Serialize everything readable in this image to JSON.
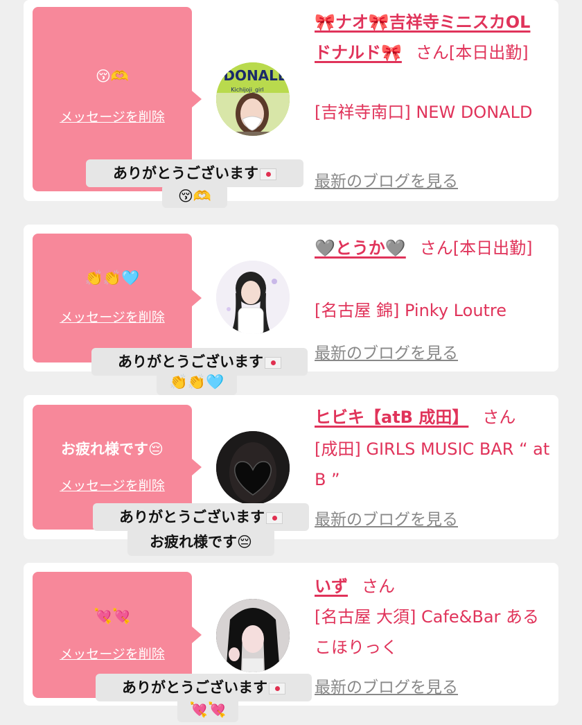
{
  "delete_label": "メッセージを削除",
  "san_label": "さん",
  "blog_label": "最新のブログを見る",
  "colors": {
    "bubble": "#f7889a",
    "link": "#e0335a",
    "muted": "#888888",
    "page_bg": "#efefef"
  },
  "entries": [
    {
      "message": "😚🫶",
      "name": "🎀ナオ🎀吉祥寺ミニスカOLドナルド🎀",
      "status": "[本日出勤]",
      "shop": "[吉祥寺南口] NEW DONALD",
      "reply_line1": "ありがとうございます",
      "reply_line2": "😚🫶",
      "avatar_text": "DONALL",
      "avatar_sub": "Kichijoji_girl",
      "avatar_icon": "girl-photo-icon"
    },
    {
      "message": "👏👏🩵",
      "name": "🩶とうか🩶",
      "status": "[本日出勤]",
      "shop": "[名古屋 錦] Pinky Loutre",
      "reply_line1": "ありがとうございます",
      "reply_line2": "👏👏🩵",
      "avatar_icon": "girl-photo-icon"
    },
    {
      "message": "お疲れ様です😔",
      "name": "ヒビキ【atB 成田】",
      "status": "",
      "shop": "[成田] GIRLS MUSIC BAR “ at B ”",
      "reply_line1": "ありがとうございます",
      "reply_line2": "お疲れ様です😔",
      "avatar_icon": "black-heart-icon"
    },
    {
      "message": "💘💘",
      "name": "いず",
      "status": "",
      "shop": "[名古屋 大須] Cafe&Bar あるこほりっく",
      "reply_line1": "ありがとうございます",
      "reply_line2": "💘💘",
      "avatar_icon": "girl-photo-icon"
    }
  ]
}
